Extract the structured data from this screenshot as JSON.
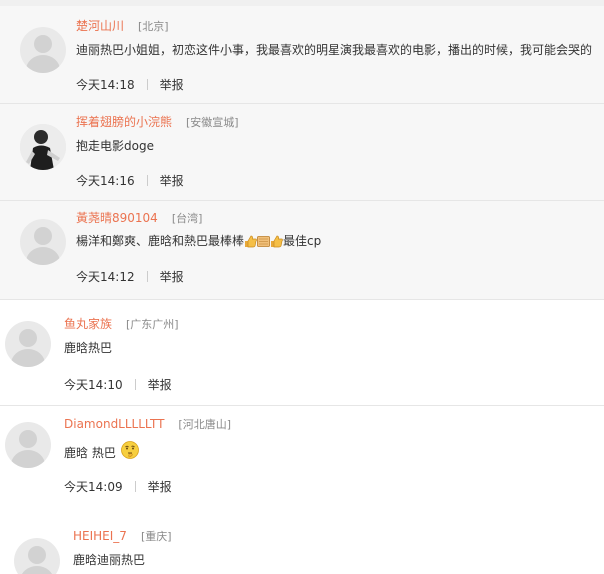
{
  "comments": [
    {
      "username": "楚河山川",
      "location": "[北京]",
      "text": "迪丽热巴小姐姐，初恋这件小事，我最喜欢的明星演我最喜欢的电影，播出的时候，我可能会哭的",
      "time": "今天14:18",
      "report": "举报"
    },
    {
      "username": "挥着翅膀的小浣熊",
      "location": "[安徽宣城]",
      "text": "抱走电影doge",
      "time": "今天14:16",
      "report": "举报"
    },
    {
      "username": "黃荛晴890104",
      "location": "[台湾]",
      "text_before": "楊洋和鄭爽、鹿晗和熱巴最棒棒",
      "text_after": "最佳cp",
      "time": "今天14:12",
      "report": "举报"
    },
    {
      "username": "鱼丸家族",
      "location": "[广东广州]",
      "text": "鹿晗热巴",
      "time": "今天14:10",
      "report": "举报"
    },
    {
      "username": "DiamondLLLLLTT",
      "location": "[河北唐山]",
      "text": "鹿晗 热巴",
      "time": "今天14:09",
      "report": "举报"
    },
    {
      "username": "HEIHEI_7",
      "location": "[重庆]",
      "text": "鹿晗迪丽热巴"
    }
  ],
  "icons": [
    "thumbs-up-icon",
    "sticker-icon",
    "thumbs-up-icon",
    "thinking-face-icon"
  ],
  "colors": {
    "username": "#eb7350",
    "location": "#8a8a8a",
    "panel": "#f7f7f7"
  }
}
